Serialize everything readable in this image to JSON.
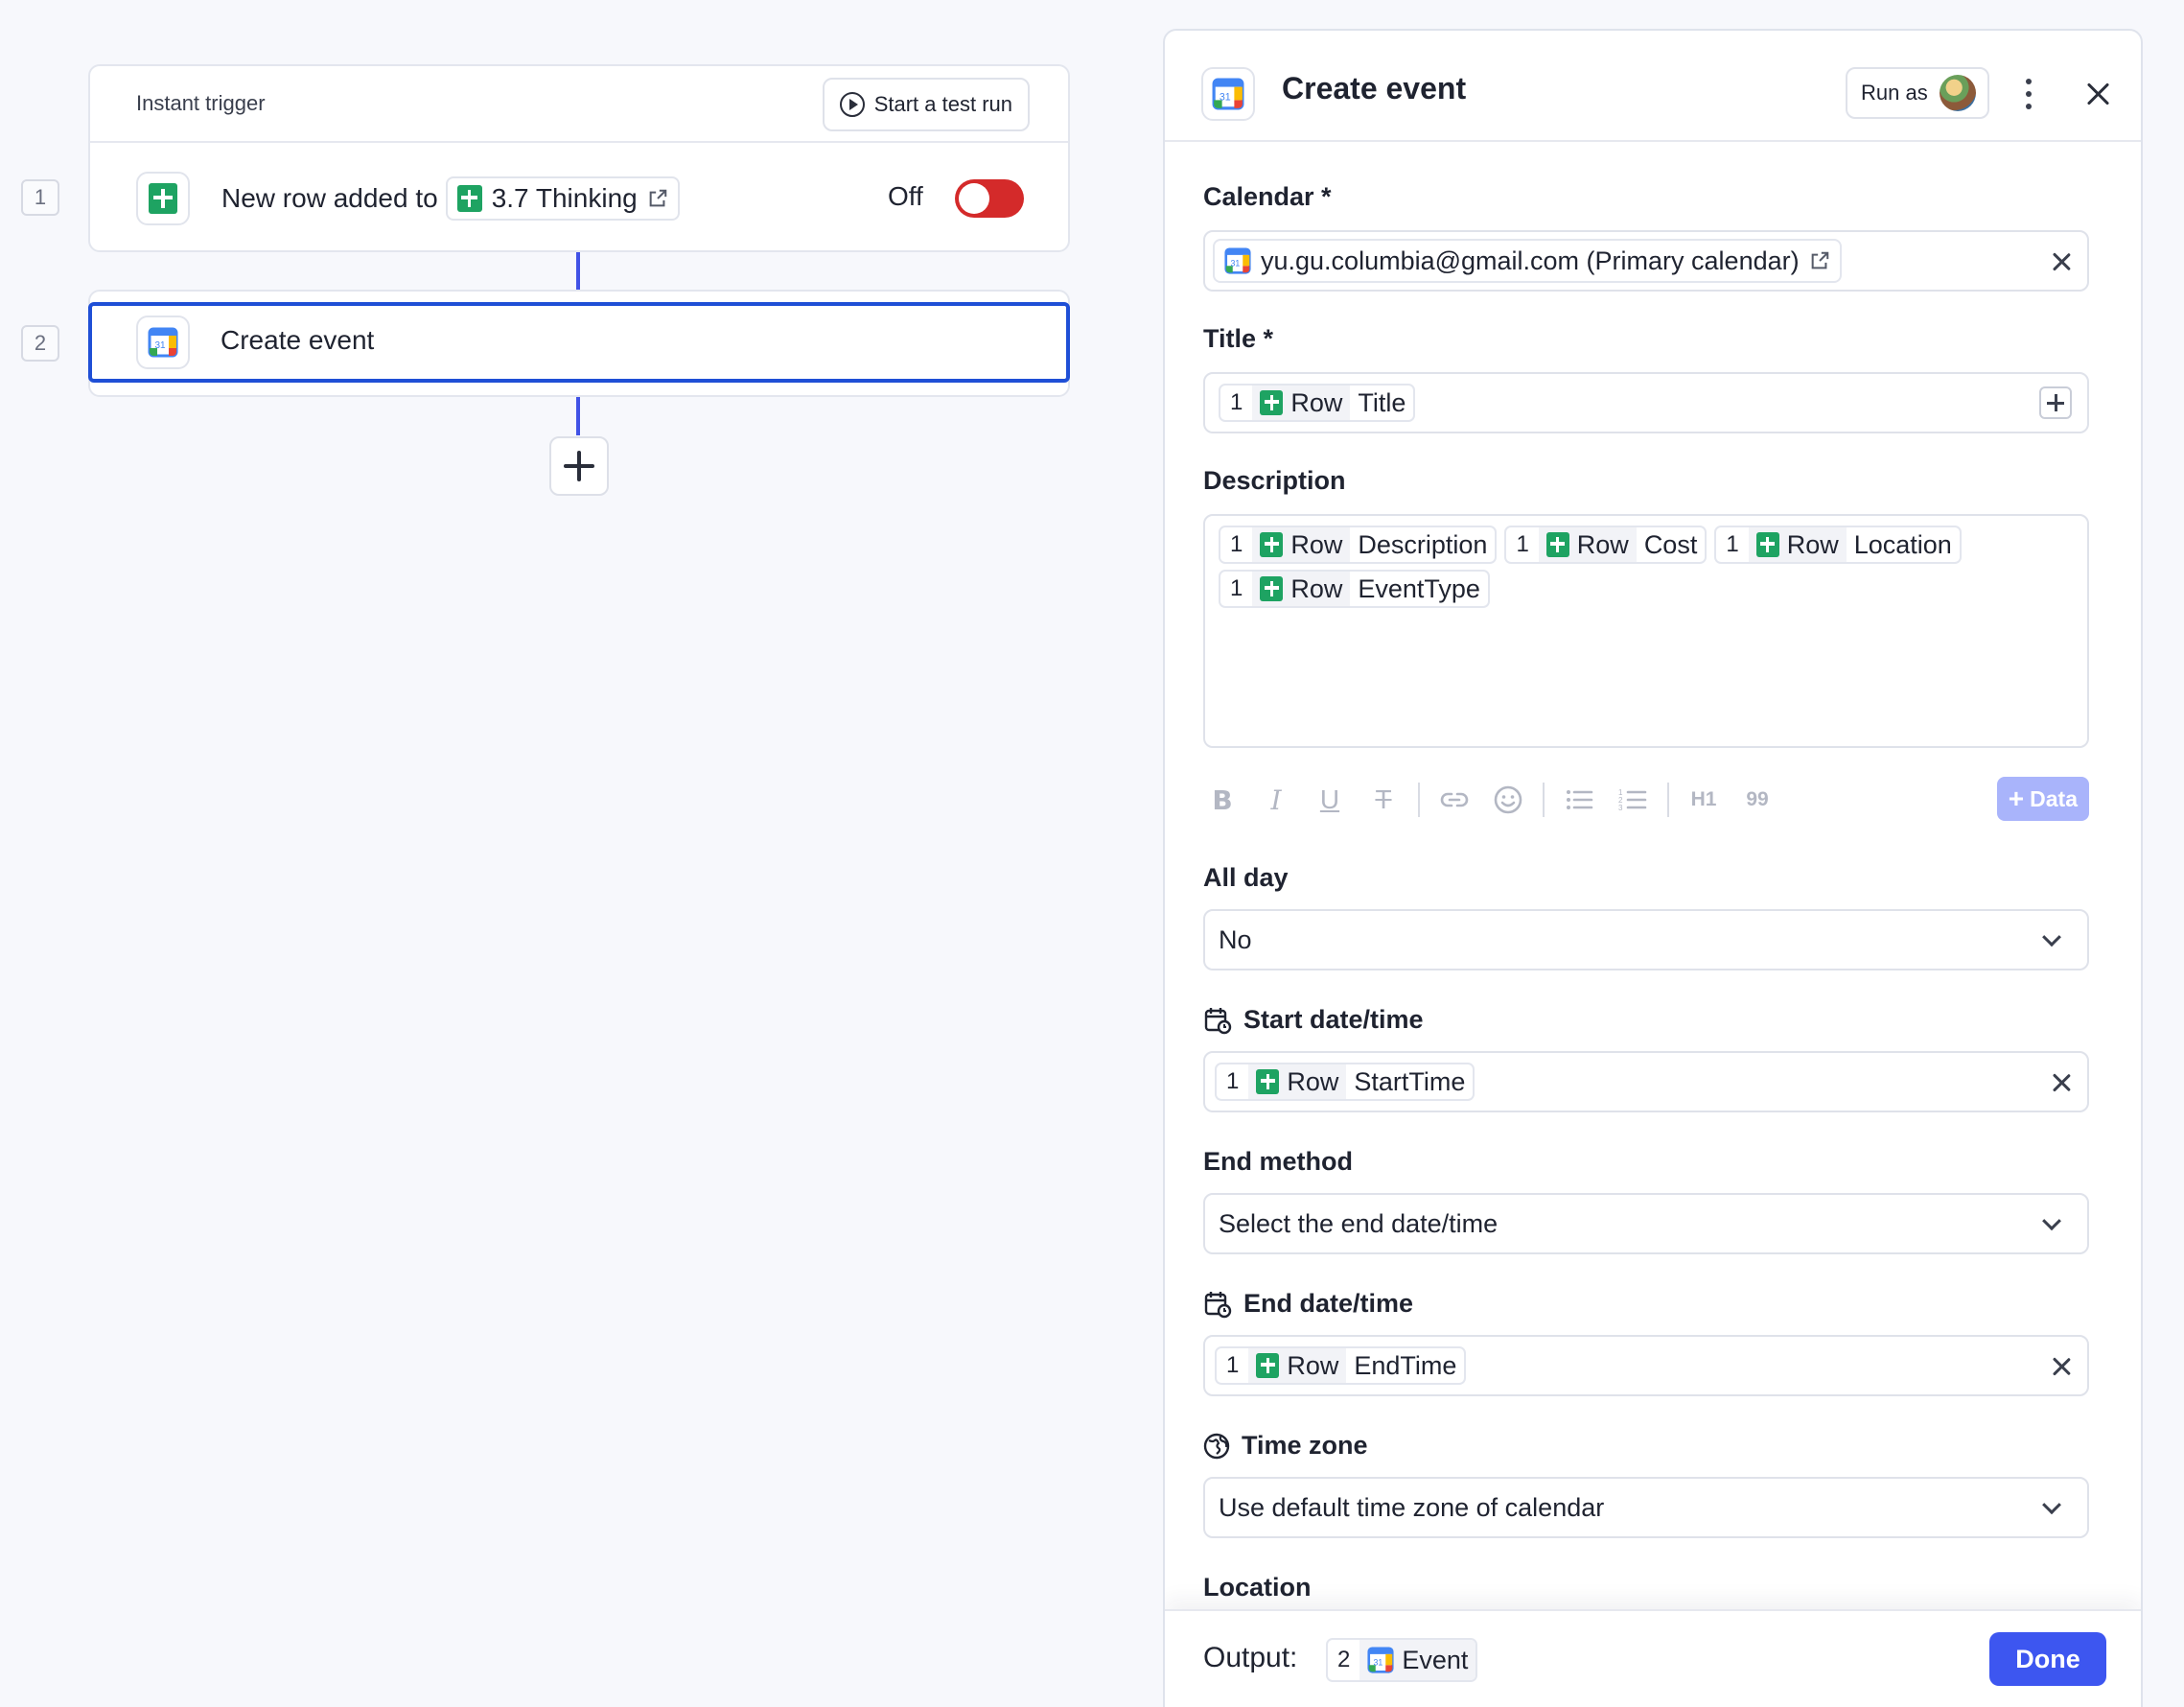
{
  "canvas": {
    "trigger": {
      "header_label": "Instant trigger",
      "test_run_label": "Start a test run",
      "step_number": "1",
      "row_prefix": "New row added to",
      "sheet_name": "3.7 Thinking",
      "toggle_label": "Off"
    },
    "action": {
      "step_number": "2",
      "label": "Create event"
    }
  },
  "panel": {
    "title": "Create event",
    "run_as_label": "Run as",
    "calendar": {
      "label": "Calendar *",
      "value": "yu.gu.columbia@gmail.com (Primary calendar)"
    },
    "title_field": {
      "label": "Title *",
      "tokens": [
        {
          "num": "1",
          "app": "Row",
          "field": "Title"
        }
      ]
    },
    "description": {
      "label": "Description",
      "tokens": [
        {
          "num": "1",
          "app": "Row",
          "field": "Description"
        },
        {
          "num": "1",
          "app": "Row",
          "field": "Cost"
        },
        {
          "num": "1",
          "app": "Row",
          "field": "Location"
        },
        {
          "num": "1",
          "app": "Row",
          "field": "EventType"
        }
      ],
      "toolbar": {
        "h1": "H1",
        "quote": "99",
        "data_label": "Data"
      }
    },
    "all_day": {
      "label": "All day",
      "value": "No"
    },
    "start": {
      "label": "Start date/time",
      "tokens": [
        {
          "num": "1",
          "app": "Row",
          "field": "StartTime"
        }
      ]
    },
    "end_method": {
      "label": "End method",
      "value": "Select the end date/time"
    },
    "end": {
      "label": "End date/time",
      "tokens": [
        {
          "num": "1",
          "app": "Row",
          "field": "EndTime"
        }
      ]
    },
    "timezone": {
      "label": "Time zone",
      "value": "Use default time zone of calendar"
    },
    "location": {
      "label": "Location"
    },
    "footer": {
      "output_label": "Output:",
      "output_token": {
        "num": "2",
        "field": "Event"
      },
      "done_label": "Done"
    }
  },
  "colors": {
    "accent": "#3d56f0",
    "connector": "#4152e6",
    "selected_border": "#1f4fd6",
    "toggle_off": "#d42a2a",
    "sheets_green": "#1ea362"
  }
}
